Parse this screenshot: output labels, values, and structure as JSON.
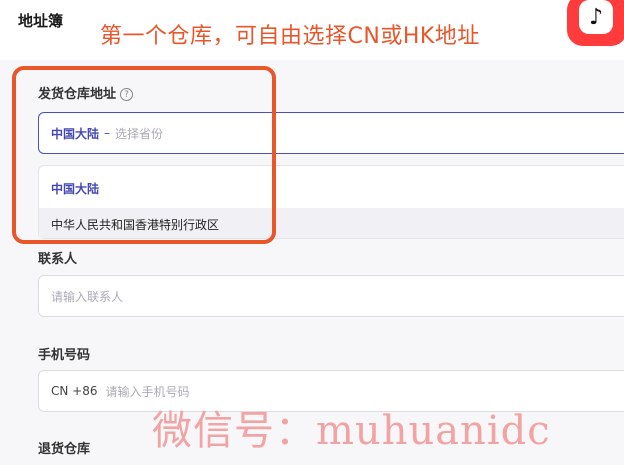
{
  "header": {
    "title": "地址簿",
    "annotation": "第一个仓库，可自由选择CN或HK地址",
    "logo_icon": "tiktok-icon"
  },
  "form": {
    "warehouse": {
      "label": "发货仓库地址",
      "help_icon": "question-icon",
      "value": "中国大陆",
      "separator": "–",
      "placeholder": "选择省份"
    },
    "dropdown": {
      "options": [
        "中国大陆",
        "中华人民共和国香港特别行政区"
      ],
      "selected": "中国大陆"
    },
    "contact": {
      "label": "联系人",
      "placeholder": "请输入联系人"
    },
    "phone": {
      "label": "手机号码",
      "country_code": "CN +86",
      "placeholder": "请输入手机号码"
    },
    "return_warehouse": {
      "label": "退货仓库"
    }
  },
  "watermark": "微信号：muhuanidc",
  "colors": {
    "accent": "#4248b8",
    "annotation": "#e8562a"
  }
}
